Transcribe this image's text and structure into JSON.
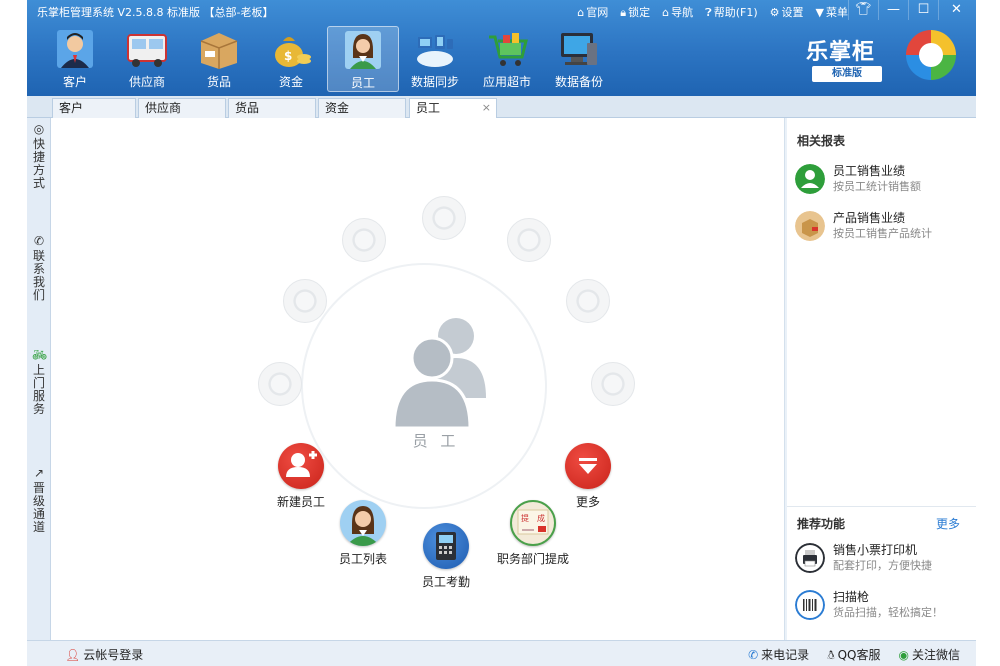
{
  "window": {
    "title": "乐掌柜管理系统 V2.5.8.8 标准版 【总部-老板】",
    "links": [
      {
        "name": "official-site",
        "glyph": "⌂",
        "label": "官网"
      },
      {
        "name": "lock",
        "glyph": "🔒︎",
        "label": "锁定"
      },
      {
        "name": "nav",
        "glyph": "⌂",
        "label": "导航"
      },
      {
        "name": "help",
        "glyph": "❓︎",
        "label": "帮助(F1)"
      },
      {
        "name": "settings",
        "glyph": "⚙",
        "label": "设置"
      },
      {
        "name": "menu",
        "glyph": "▼",
        "label": "菜单"
      }
    ],
    "controls": {
      "skin": "👕︎",
      "minimize": "—",
      "maximize": "☐",
      "close": "✕"
    }
  },
  "modules": [
    {
      "label": "客户",
      "icon": "customer-avatar-icon"
    },
    {
      "label": "供应商",
      "icon": "supplier-truck-icon"
    },
    {
      "label": "货品",
      "icon": "goods-box-icon"
    },
    {
      "label": "资金",
      "icon": "money-bag-icon"
    },
    {
      "label": "员工",
      "icon": "employee-avatar-icon",
      "active": true
    },
    {
      "label": "数据同步",
      "icon": "data-sync-icon"
    },
    {
      "label": "应用超市",
      "icon": "app-market-cart-icon"
    },
    {
      "label": "数据备份",
      "icon": "data-backup-icon"
    }
  ],
  "brand": {
    "name": "乐掌柜",
    "edition": "标准版"
  },
  "tabs": [
    {
      "label": "客户"
    },
    {
      "label": "供应商"
    },
    {
      "label": "货品"
    },
    {
      "label": "资金"
    },
    {
      "label": "员工",
      "active": true,
      "close": "×"
    }
  ],
  "sidebar": [
    {
      "name": "shortcuts",
      "glyph": "◎",
      "label": "快捷方式"
    },
    {
      "name": "contact",
      "glyph": "✆",
      "label": "联系我们"
    },
    {
      "name": "onsite-service",
      "glyph": "🚲︎",
      "label": "上门服务"
    },
    {
      "name": "upgrade",
      "glyph": "↗",
      "label": "晋级通道"
    }
  ],
  "main": {
    "center_label": "员 工",
    "actions": {
      "new_employee": "新建员工",
      "more": "更多",
      "employee_list": "员工列表",
      "attendance": "员工考勤",
      "commission": "职务部门提成",
      "commission_stamp": [
        "提",
        "成"
      ]
    }
  },
  "right_panel": {
    "reports_title": "相关报表",
    "reports": [
      {
        "name": "员工销售业绩",
        "desc": "按员工统计销售额"
      },
      {
        "name": "产品销售业绩",
        "desc": "按员工销售产品统计"
      }
    ],
    "recommend_title": "推荐功能",
    "more": "更多",
    "recommend": [
      {
        "name": "销售小票打印机",
        "desc": "配套打印，方便快捷"
      },
      {
        "name": "扫描枪",
        "desc": "货品扫描，轻松搞定！"
      }
    ]
  },
  "statusbar": {
    "login": "云帐号登录",
    "call_log": "来电记录",
    "qq_service": "QQ客服",
    "wechat": "关注微信"
  },
  "colors": {
    "header": "#2c74c2",
    "accent_red": "#d9342b",
    "link_blue": "#2b7cd3"
  }
}
